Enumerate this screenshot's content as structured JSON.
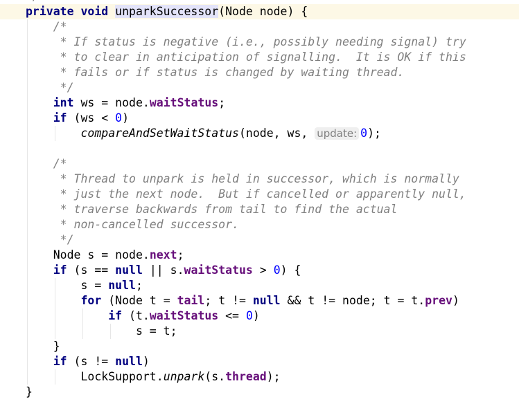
{
  "editor": {
    "partial_top_line": "*/",
    "current_line_index": 0,
    "lines": [
      [
        [
          "private void ",
          "kw"
        ],
        [
          "unparkSuccessor",
          "decl"
        ],
        [
          "(Node node) {",
          ""
        ]
      ],
      [
        [
          "    /*",
          "cm"
        ]
      ],
      [
        [
          "     * If status is negative (i.e., possibly needing signal) try",
          "cm"
        ]
      ],
      [
        [
          "     * to clear in anticipation of signalling.  It is OK if this",
          "cm"
        ]
      ],
      [
        [
          "     * fails or if status is changed by waiting thread.",
          "cm"
        ]
      ],
      [
        [
          "     */",
          "cm"
        ]
      ],
      [
        [
          "    ",
          ""
        ],
        [
          "int",
          "kw"
        ],
        [
          " ws = node.",
          ""
        ],
        [
          "waitStatus",
          "field"
        ],
        [
          ";",
          ""
        ]
      ],
      [
        [
          "    ",
          ""
        ],
        [
          "if",
          "kw"
        ],
        [
          " (ws < ",
          ""
        ],
        [
          "0",
          "num"
        ],
        [
          ")",
          ""
        ]
      ],
      [
        [
          "        ",
          ""
        ],
        [
          "compareAndSetWaitStatus",
          "st"
        ],
        [
          "(node, ws, ",
          ""
        ],
        [
          "update:",
          "hint"
        ],
        [
          "0",
          "num"
        ],
        [
          ");",
          ""
        ]
      ],
      [],
      [
        [
          "    /*",
          "cm"
        ]
      ],
      [
        [
          "     * Thread to unpark is held in successor, which is normally",
          "cm"
        ]
      ],
      [
        [
          "     * just the next node.  But if cancelled or apparently null,",
          "cm"
        ]
      ],
      [
        [
          "     * traverse backwards from tail to find the actual",
          "cm"
        ]
      ],
      [
        [
          "     * non-cancelled successor.",
          "cm"
        ]
      ],
      [
        [
          "     */",
          "cm"
        ]
      ],
      [
        [
          "    Node s = node.",
          ""
        ],
        [
          "next",
          "field"
        ],
        [
          ";",
          ""
        ]
      ],
      [
        [
          "    ",
          ""
        ],
        [
          "if",
          "kw"
        ],
        [
          " (s == ",
          ""
        ],
        [
          "null",
          "kw"
        ],
        [
          " || s.",
          ""
        ],
        [
          "waitStatus",
          "field"
        ],
        [
          " > ",
          ""
        ],
        [
          "0",
          "num"
        ],
        [
          ") {",
          ""
        ]
      ],
      [
        [
          "        s = ",
          ""
        ],
        [
          "null",
          "kw"
        ],
        [
          ";",
          ""
        ]
      ],
      [
        [
          "        ",
          ""
        ],
        [
          "for",
          "kw"
        ],
        [
          " (Node t = ",
          ""
        ],
        [
          "tail",
          "field"
        ],
        [
          "; t != ",
          ""
        ],
        [
          "null",
          "kw"
        ],
        [
          " && t != node; t = t.",
          ""
        ],
        [
          "prev",
          "field"
        ],
        [
          ")",
          ""
        ]
      ],
      [
        [
          "            ",
          ""
        ],
        [
          "if",
          "kw"
        ],
        [
          " (t.",
          ""
        ],
        [
          "waitStatus",
          "field"
        ],
        [
          " <= ",
          ""
        ],
        [
          "0",
          "num"
        ],
        [
          ")",
          ""
        ]
      ],
      [
        [
          "                s = t;",
          ""
        ]
      ],
      [
        [
          "    }",
          ""
        ]
      ],
      [
        [
          "    ",
          ""
        ],
        [
          "if",
          "kw"
        ],
        [
          " (s != ",
          ""
        ],
        [
          "null",
          "kw"
        ],
        [
          ")",
          ""
        ]
      ],
      [
        [
          "        LockSupport.",
          ""
        ],
        [
          "unpark",
          "st"
        ],
        [
          "(s.",
          ""
        ],
        [
          "thread",
          "field"
        ],
        [
          ");",
          ""
        ]
      ],
      [
        [
          "}",
          ""
        ]
      ]
    ]
  }
}
